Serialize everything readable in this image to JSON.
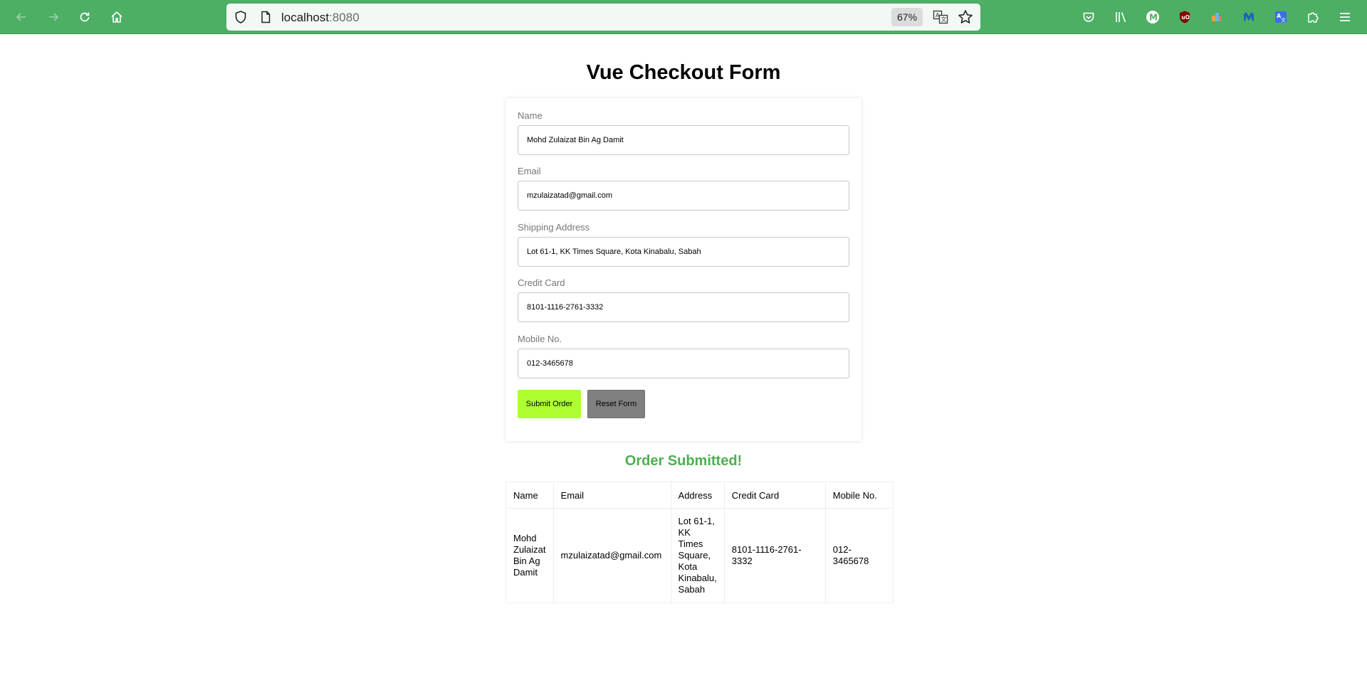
{
  "browser": {
    "url_host": "localhost",
    "url_port": ":8080",
    "zoom": "67%",
    "icons": {
      "back": "back-arrow-icon",
      "forward": "forward-arrow-icon",
      "reload": "reload-icon",
      "home": "home-icon",
      "tracking": "shield-icon",
      "page": "page-icon",
      "translate": "translate-icon",
      "bookmark": "star-icon",
      "pocket": "pocket-icon",
      "library": "library-icon",
      "ext_m": "m-extension-icon",
      "ublock": "ublock-icon",
      "ext_color": "color-extension-icon",
      "ext_malwarebytes": "malwarebytes-icon",
      "ext_translate": "translate-extension-icon",
      "extensions": "puzzle-icon",
      "menu": "hamburger-menu-icon"
    },
    "colors": {
      "toolbar": "#4caf63",
      "urlbar": "#f2f8f3"
    }
  },
  "page": {
    "title": "Vue Checkout Form",
    "form": {
      "fields": [
        {
          "label": "Name",
          "value": "Mohd Zulaizat Bin Ag Damit"
        },
        {
          "label": "Email",
          "value": "mzulaizatad@gmail.com"
        },
        {
          "label": "Shipping Address",
          "value": "Lot 61-1, KK Times Square, Kota Kinabalu, Sabah"
        },
        {
          "label": "Credit Card",
          "value": "8101-1116-2761-3332"
        },
        {
          "label": "Mobile No.",
          "value": "012-3465678"
        }
      ],
      "submit_label": "Submit Order",
      "reset_label": "Reset Form",
      "colors": {
        "submit": "#adff2f",
        "reset": "#808080"
      }
    },
    "submitted_message": "Order Submitted!",
    "submitted_color": "#4caf50",
    "table": {
      "headers": [
        "Name",
        "Email",
        "Address",
        "Credit Card",
        "Mobile No."
      ],
      "rows": [
        {
          "name_lines": [
            "Mohd",
            "Zulaizat",
            "Bin Ag",
            "Damit"
          ],
          "email": "mzulaizatad@gmail.com",
          "address_lines": [
            "Lot 61-1,",
            "KK",
            "Times",
            "Square,",
            "Kota",
            "Kinabalu,",
            "Sabah"
          ],
          "credit_card": "8101-1116-2761-3332",
          "mobile": "012-3465678"
        }
      ]
    }
  }
}
